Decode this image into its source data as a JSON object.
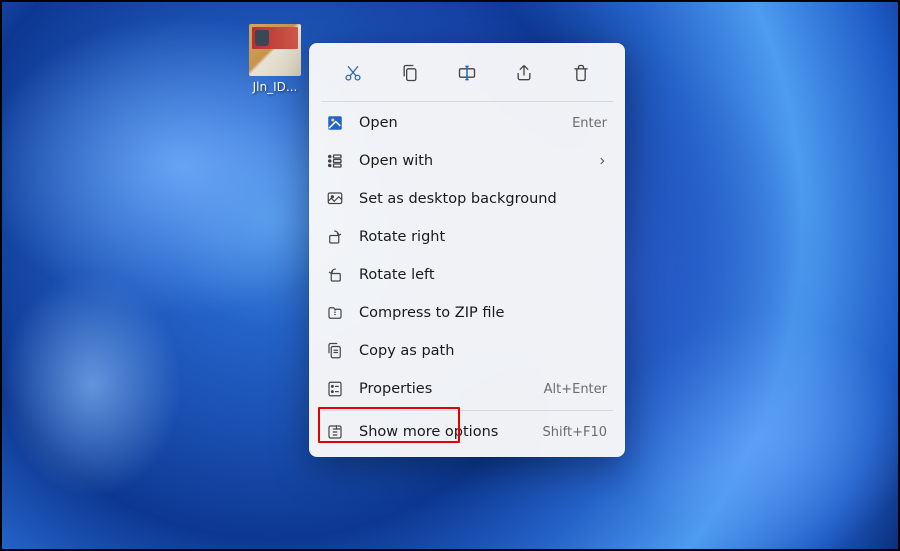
{
  "desktop": {
    "file_label": "Jln_ID..."
  },
  "quick_actions": [
    {
      "name": "cut-action",
      "icon": "cut-icon"
    },
    {
      "name": "copy-action",
      "icon": "copy-icon"
    },
    {
      "name": "rename-action",
      "icon": "rename-icon"
    },
    {
      "name": "share-action",
      "icon": "share-icon"
    },
    {
      "name": "delete-action",
      "icon": "delete-icon"
    }
  ],
  "menu": {
    "open": {
      "label": "Open",
      "shortcut": "Enter"
    },
    "open_with": {
      "label": "Open with",
      "submenu": true
    },
    "set_bg": {
      "label": "Set as desktop background"
    },
    "rotate_right": {
      "label": "Rotate right"
    },
    "rotate_left": {
      "label": "Rotate left"
    },
    "compress": {
      "label": "Compress to ZIP file"
    },
    "copy_path": {
      "label": "Copy as path"
    },
    "properties": {
      "label": "Properties",
      "shortcut": "Alt+Enter"
    },
    "more": {
      "label": "Show more options",
      "shortcut": "Shift+F10"
    }
  },
  "highlight_target": "properties"
}
